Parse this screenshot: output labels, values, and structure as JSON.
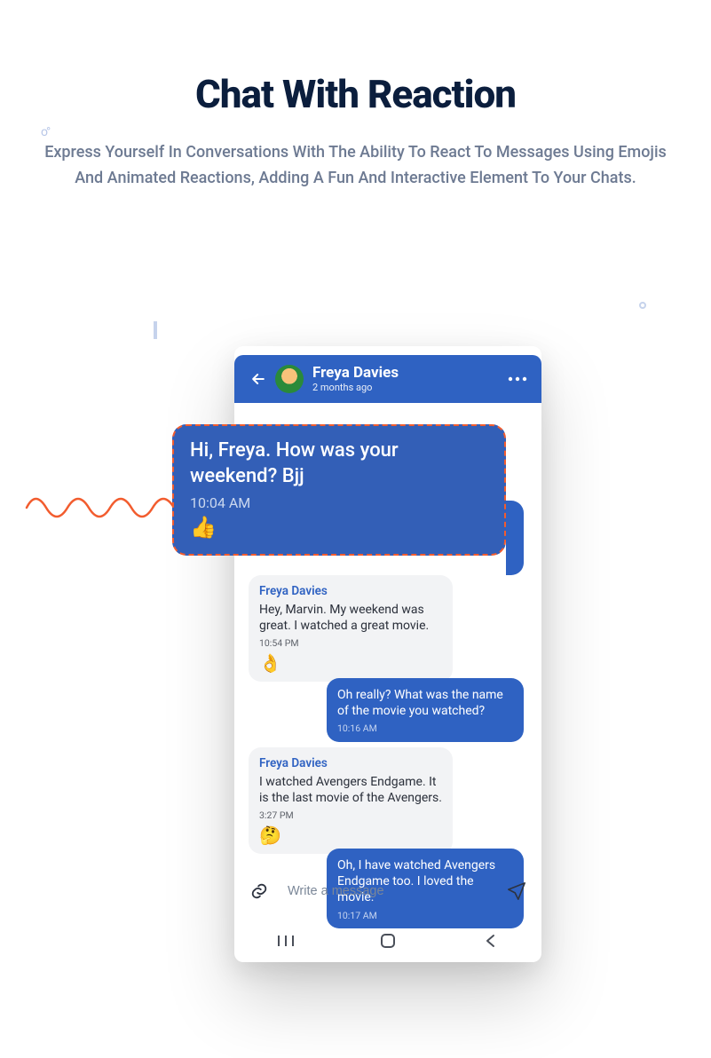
{
  "page": {
    "title": "Chat With Reaction",
    "subtitle": "Express Yourself In Conversations With The Ability To React To Messages Using Emojis And Animated Reactions, Adding A Fun And Interactive Element To Your Chats."
  },
  "chat": {
    "header": {
      "name": "Freya Davies",
      "subtitle": "2 months ago"
    },
    "callout": {
      "text": "Hi, Freya. How was your weekend? Bjj",
      "time": "10:04 AM",
      "reaction": "👍"
    },
    "messages": {
      "m2": {
        "sender": "Freya Davies",
        "text": "Hey, Marvin. My weekend was great. I watched a great movie.",
        "time": "10:54 PM",
        "reaction": "👌"
      },
      "m3": {
        "text": "Oh really? What was the name of the movie you watched?",
        "time": "10:16 AM"
      },
      "m4": {
        "sender": "Freya Davies",
        "text": "I watched Avengers Endgame. It is the last movie of the Avengers.",
        "time": "3:27 PM",
        "reaction": "🤔"
      },
      "m5": {
        "text": "Oh, I have watched Avengers Endgame too. I loved the movie.",
        "time": "10:17 AM"
      }
    },
    "input": {
      "placeholder": "Write a message"
    }
  }
}
